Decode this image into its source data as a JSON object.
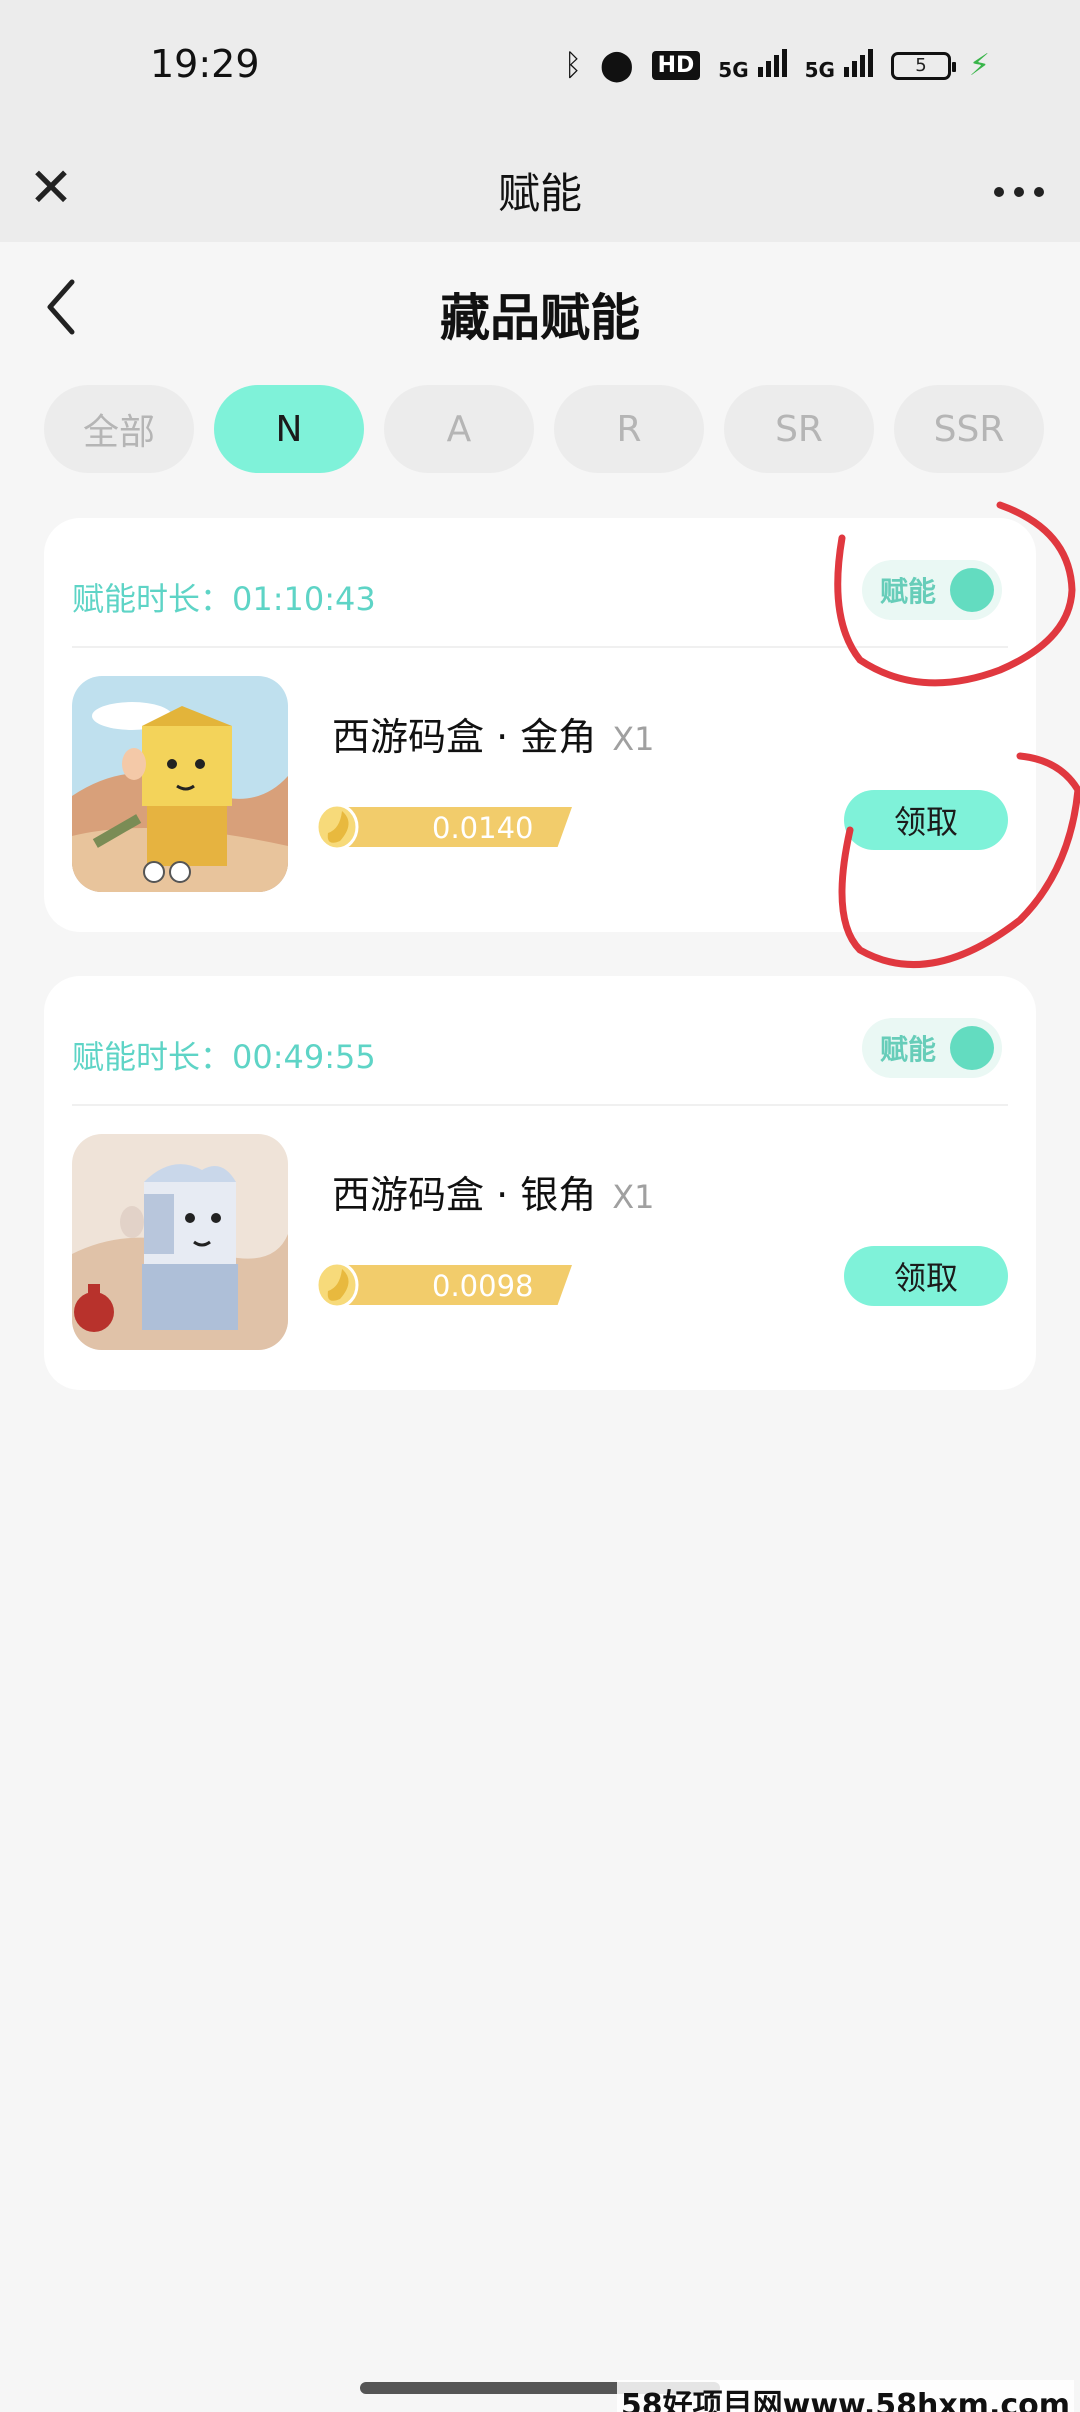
{
  "status_bar": {
    "time": "19:29",
    "network_1": "5G",
    "network_2": "5G",
    "hd_label": "HD",
    "battery": "5"
  },
  "app_header": {
    "title": "赋能",
    "close_icon": "close-icon",
    "more_icon": "more-icon"
  },
  "page": {
    "title": "藏品赋能"
  },
  "tabs": [
    {
      "label": "全部",
      "active": false
    },
    {
      "label": "N",
      "active": true
    },
    {
      "label": "A",
      "active": false
    },
    {
      "label": "R",
      "active": false
    },
    {
      "label": "SR",
      "active": false
    },
    {
      "label": "SSR",
      "active": false
    }
  ],
  "cards": [
    {
      "duration": "赋能时长：01:10:43",
      "toggle_label": "赋能",
      "name": "西游码盒 · 金角",
      "qty": "X1",
      "value": "0.0140",
      "claim_label": "领取"
    },
    {
      "duration": "赋能时长：00:49:55",
      "toggle_label": "赋能",
      "name": "西游码盒 · 银角",
      "qty": "X1",
      "value": "0.0098",
      "claim_label": "领取"
    }
  ],
  "watermark": "58好项目网www.58hxm.com",
  "colors": {
    "accent": "#7ff2d9",
    "duration_text": "#5ed4c6",
    "value_pill": "#f2cc6b",
    "annotation": "#e0383f"
  }
}
